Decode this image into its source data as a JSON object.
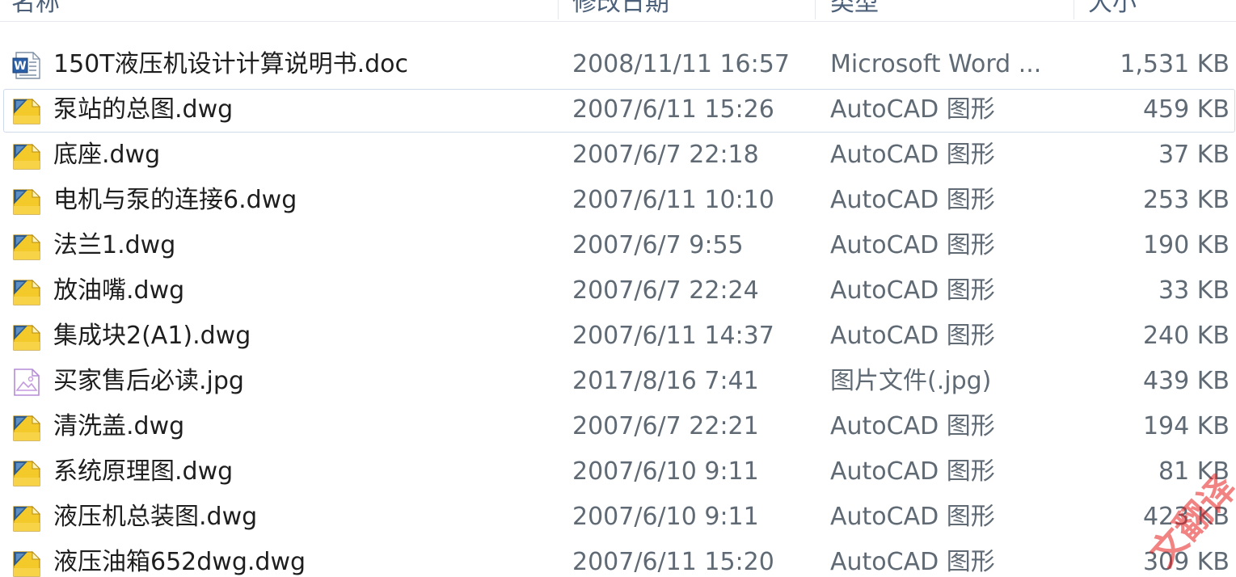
{
  "columns": {
    "name": "名称",
    "date": "修改日期",
    "type": "类型",
    "size": "大小"
  },
  "files": [
    {
      "name": "150T液压机设计计算说明书.doc",
      "date": "2008/11/11 16:57",
      "type": "Microsoft Word ...",
      "size": "1,531 KB",
      "icon": "word-doc-icon"
    },
    {
      "name": "泵站的总图.dwg",
      "date": "2007/6/11 15:26",
      "type": "AutoCAD 图形",
      "size": "459 KB",
      "icon": "autocad-dwg-icon"
    },
    {
      "name": "底座.dwg",
      "date": "2007/6/7 22:18",
      "type": "AutoCAD 图形",
      "size": "37 KB",
      "icon": "autocad-dwg-icon"
    },
    {
      "name": "电机与泵的连接6.dwg",
      "date": "2007/6/11 10:10",
      "type": "AutoCAD 图形",
      "size": "253 KB",
      "icon": "autocad-dwg-icon"
    },
    {
      "name": "法兰1.dwg",
      "date": "2007/6/7 9:55",
      "type": "AutoCAD 图形",
      "size": "190 KB",
      "icon": "autocad-dwg-icon"
    },
    {
      "name": "放油嘴.dwg",
      "date": "2007/6/7 22:24",
      "type": "AutoCAD 图形",
      "size": "33 KB",
      "icon": "autocad-dwg-icon"
    },
    {
      "name": "集成块2(A1).dwg",
      "date": "2007/6/11 14:37",
      "type": "AutoCAD 图形",
      "size": "240 KB",
      "icon": "autocad-dwg-icon"
    },
    {
      "name": "买家售后必读.jpg",
      "date": "2017/8/16 7:41",
      "type": "图片文件(.jpg)",
      "size": "439 KB",
      "icon": "image-file-icon"
    },
    {
      "name": "清洗盖.dwg",
      "date": "2007/6/7 22:21",
      "type": "AutoCAD 图形",
      "size": "194 KB",
      "icon": "autocad-dwg-icon"
    },
    {
      "name": "系统原理图.dwg",
      "date": "2007/6/10 9:11",
      "type": "AutoCAD 图形",
      "size": "81 KB",
      "icon": "autocad-dwg-icon"
    },
    {
      "name": "液压机总装图.dwg",
      "date": "2007/6/10 9:11",
      "type": "AutoCAD 图形",
      "size": "423 KB",
      "icon": "autocad-dwg-icon"
    },
    {
      "name": "液压油箱652dwg.dwg",
      "date": "2007/6/11 15:20",
      "type": "AutoCAD 图形",
      "size": "309 KB",
      "icon": "autocad-dwg-icon"
    }
  ],
  "selected_index": 1,
  "watermark": "文翻译"
}
